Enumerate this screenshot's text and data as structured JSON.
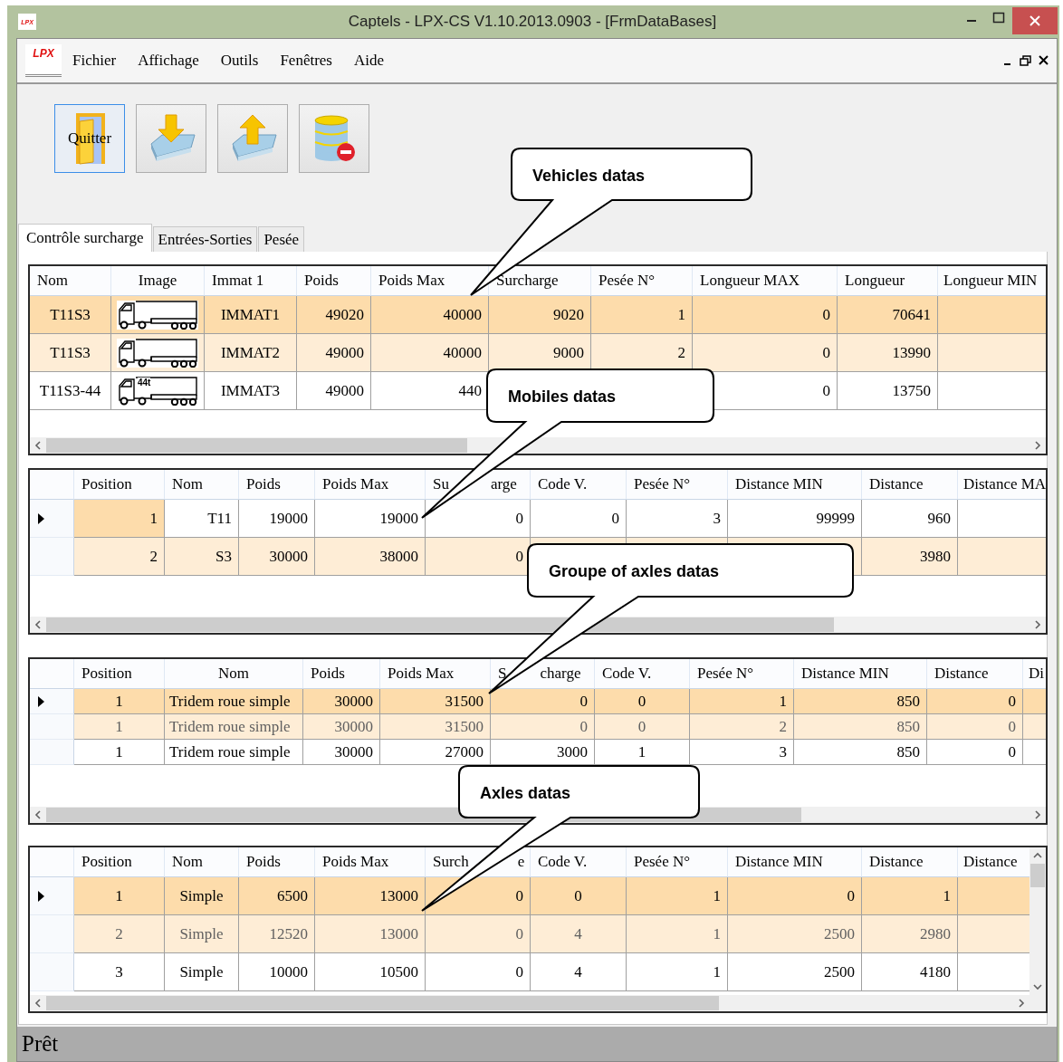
{
  "window": {
    "title": "Captels - LPX-CS V1.10.2013.0903 - [FrmDataBases]",
    "icon_text": "LPX"
  },
  "menubar": {
    "logo_text": "LPX",
    "items": [
      "Fichier",
      "Affichage",
      "Outils",
      "Fenêtres",
      "Aide"
    ]
  },
  "toolbar": [
    {
      "kind": "quit",
      "label": "Quitter",
      "selected": true
    },
    {
      "kind": "download",
      "selected": false
    },
    {
      "kind": "upload",
      "selected": false
    },
    {
      "kind": "db-delete",
      "selected": false
    }
  ],
  "tabs": [
    {
      "label": "Contrôle surcharge",
      "selected": true
    },
    {
      "label": "Entrées-Sorties",
      "selected": false
    },
    {
      "label": "Pesée",
      "selected": false
    }
  ],
  "tables": [
    {
      "row_header": false,
      "vscroll": false,
      "columns": [
        "Nom",
        "Image",
        "Immat 1",
        "Poids",
        "Poids Max",
        "Surcharge",
        "Pesée N°",
        "Longueur MAX",
        "Longueur",
        "Longueur MIN"
      ],
      "rows": [
        {
          "selected": true,
          "current": false,
          "dimmed": false,
          "cells": [
            "T11S3",
            {
              "kind": "truck"
            },
            "IMMAT1",
            "49020",
            "40000",
            "9020",
            "1",
            "0",
            "70641"
          ]
        },
        {
          "selected": false,
          "current": false,
          "dimmed": false,
          "cells": [
            "T11S3",
            {
              "kind": "truck"
            },
            "IMMAT2",
            "49000",
            "40000",
            "9000",
            "2",
            "0",
            "13990"
          ]
        },
        {
          "selected": false,
          "current": false,
          "dimmed": false,
          "cells": [
            "T11S3-44",
            {
              "kind": "truck",
              "label": "44t"
            },
            "IMMAT3",
            "49000",
            "440",
            null,
            null,
            "0",
            "13750"
          ]
        }
      ]
    },
    {
      "row_header": true,
      "vscroll": false,
      "columns": [
        "Position",
        "Nom",
        "Poids",
        "Poids Max",
        [
          "Su",
          "arge"
        ],
        "Code V.",
        "Pesée N°",
        "Distance MIN",
        "Distance",
        "Distance MA"
      ],
      "rows": [
        {
          "selected": false,
          "current": true,
          "dimmed": false,
          "cells": [
            "1",
            "T11",
            "19000",
            "19000",
            "0",
            "0",
            "3",
            "99999",
            "960"
          ]
        },
        {
          "selected": false,
          "current": false,
          "dimmed": false,
          "cells": [
            "2",
            "S3",
            "30000",
            "38000",
            "0",
            null,
            null,
            null,
            "3980"
          ]
        }
      ]
    },
    {
      "row_header": true,
      "vscroll": false,
      "columns": [
        "Position",
        "Nom",
        "Poids",
        "Poids Max",
        [
          "S",
          "charge"
        ],
        "Code V.",
        "Pesée N°",
        "Distance MIN",
        "Distance",
        "Di"
      ],
      "rows": [
        {
          "selected": true,
          "current": true,
          "dimmed": false,
          "cells": [
            "1",
            "Tridem roue simple",
            "30000",
            "31500",
            "0",
            "0",
            "1",
            "850",
            "0"
          ]
        },
        {
          "selected": false,
          "current": false,
          "dimmed": true,
          "cells": [
            "1",
            "Tridem roue simple",
            "30000",
            "31500",
            "0",
            "0",
            "2",
            "850",
            "0"
          ]
        },
        {
          "selected": false,
          "current": false,
          "dimmed": false,
          "cells": [
            "1",
            "Tridem roue simple",
            "30000",
            "27000",
            "3000",
            "1",
            "3",
            "850",
            "0"
          ]
        }
      ]
    },
    {
      "row_header": true,
      "vscroll": true,
      "columns": [
        "Position",
        "Nom",
        "Poids",
        "Poids Max",
        [
          "Surch",
          "e"
        ],
        "Code V.",
        "Pesée N°",
        "Distance MIN",
        "Distance",
        "Distance"
      ],
      "rows": [
        {
          "selected": true,
          "current": true,
          "dimmed": false,
          "cells": [
            "1",
            "Simple",
            "6500",
            "13000",
            "0",
            "0",
            "1",
            "0",
            "1"
          ]
        },
        {
          "selected": false,
          "current": false,
          "dimmed": true,
          "cells": [
            "2",
            "Simple",
            "12520",
            "13000",
            "0",
            "4",
            "1",
            "2500",
            "2980"
          ]
        },
        {
          "selected": false,
          "current": false,
          "dimmed": false,
          "cells": [
            "3",
            "Simple",
            "10000",
            "10500",
            "0",
            "4",
            "1",
            "2500",
            "4180"
          ]
        }
      ]
    }
  ],
  "callouts": [
    "Vehicles datas",
    "Mobiles datas",
    "Groupe of axles datas",
    "Axles datas"
  ],
  "status_bar": "Prêt"
}
